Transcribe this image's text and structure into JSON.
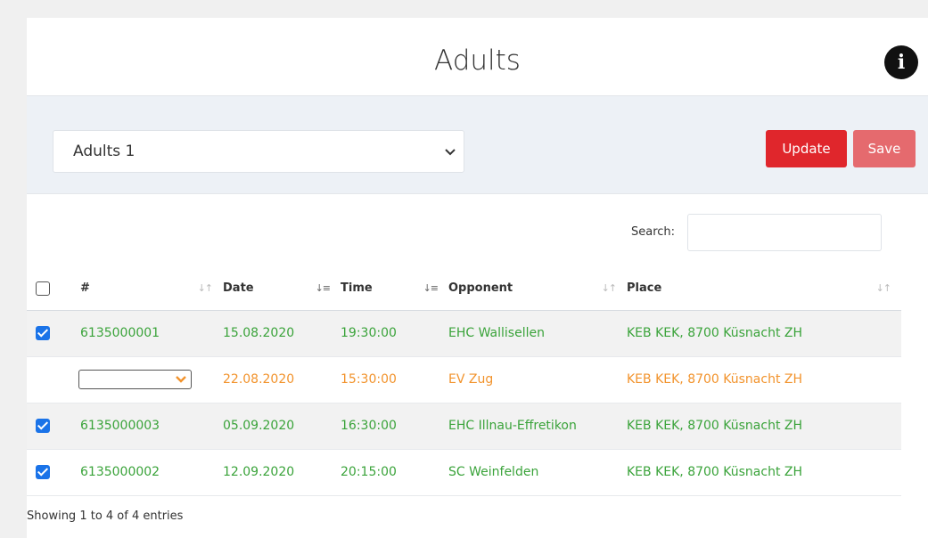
{
  "header": {
    "title": "Adults",
    "info_icon": "info-icon",
    "info_glyph": "i"
  },
  "toolbar": {
    "select_value": "Adults 1",
    "update_label": "Update",
    "save_label": "Save",
    "colors": {
      "update": "#e0262c",
      "save": "#e56a6e"
    }
  },
  "search": {
    "label": "Search:",
    "value": ""
  },
  "table": {
    "columns": [
      "#",
      "Date",
      "Time",
      "Opponent",
      "Place"
    ],
    "rows": [
      {
        "checked": true,
        "number": "6135000001",
        "date": "15.08.2020",
        "time": "19:30:00",
        "opponent": "EHC Wallisellen",
        "place": "KEB KEK, 8700 Küsnacht ZH",
        "status": "confirmed"
      },
      {
        "checked": false,
        "number": "",
        "date": "22.08.2020",
        "time": "15:30:00",
        "opponent": "EV Zug",
        "place": "KEB KEK, 8700 Küsnacht ZH",
        "status": "pending"
      },
      {
        "checked": true,
        "number": "6135000003",
        "date": "05.09.2020",
        "time": "16:30:00",
        "opponent": "EHC Illnau-Effretikon",
        "place": "KEB KEK, 8700 Küsnacht ZH",
        "status": "confirmed"
      },
      {
        "checked": true,
        "number": "6135000002",
        "date": "12.09.2020",
        "time": "20:15:00",
        "opponent": "SC Weinfelden",
        "place": "KEB KEK, 8700 Küsnacht ZH",
        "status": "confirmed"
      }
    ],
    "status_colors": {
      "confirmed": "#3aa33a",
      "pending": "#f2932c"
    }
  },
  "footer": {
    "info": "Showing 1 to 4 of 4 entries"
  }
}
